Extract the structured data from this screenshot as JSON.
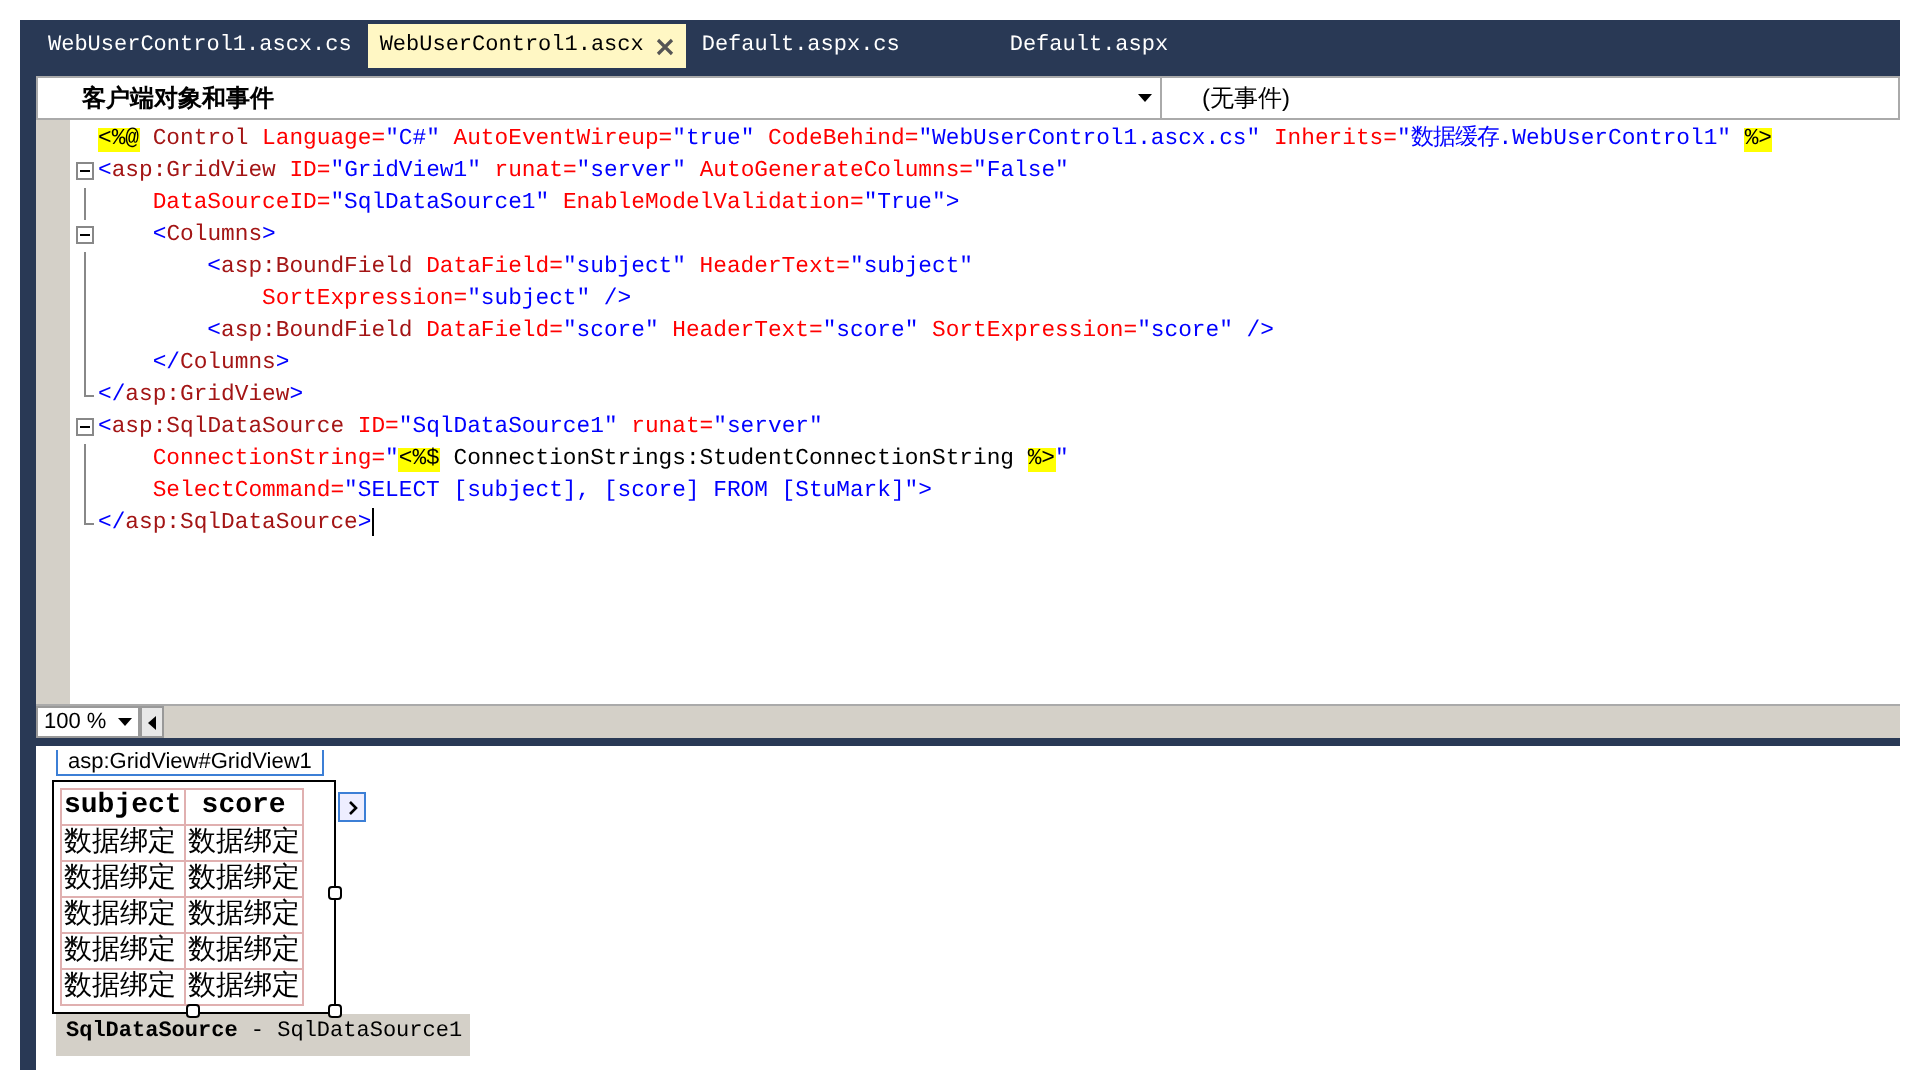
{
  "tabs": [
    {
      "label": "WebUserControl1.ascx.cs",
      "selected": false,
      "closable": false
    },
    {
      "label": "WebUserControl1.ascx",
      "selected": true,
      "closable": true
    },
    {
      "label": "Default.aspx.cs",
      "selected": false,
      "closable": false
    },
    {
      "label": "Default.aspx",
      "selected": false,
      "closable": false
    }
  ],
  "navigation": {
    "object_dropdown": "客户端对象和事件",
    "event_dropdown": "(无事件)"
  },
  "code_lines": [
    {
      "kind": "plain",
      "tokens": [
        {
          "kind": "directive",
          "text": "<%@"
        },
        {
          "kind": "element",
          "text": " Control "
        },
        {
          "kind": "attr",
          "text": "Language="
        },
        {
          "kind": "value",
          "text": "\"C#\" "
        },
        {
          "kind": "attr",
          "text": "AutoEventWireup="
        },
        {
          "kind": "value",
          "text": "\"true\" "
        },
        {
          "kind": "attr",
          "text": "CodeBehind="
        },
        {
          "kind": "value",
          "text": "\"WebUserControl1.ascx.cs\" "
        },
        {
          "kind": "attr",
          "text": "Inherits="
        },
        {
          "kind": "value",
          "text": "\"数据缓存.WebUserControl1\" "
        },
        {
          "kind": "directive",
          "text": "%>"
        }
      ]
    },
    {
      "kind": "fold-start",
      "tokens": [
        {
          "kind": "punct",
          "text": "<"
        },
        {
          "kind": "element",
          "text": "asp:GridView "
        },
        {
          "kind": "attr",
          "text": "ID="
        },
        {
          "kind": "value",
          "text": "\"GridView1\" "
        },
        {
          "kind": "attr",
          "text": "runat="
        },
        {
          "kind": "value",
          "text": "\"server\" "
        },
        {
          "kind": "attr",
          "text": "AutoGenerateColumns="
        },
        {
          "kind": "value",
          "text": "\"False\""
        }
      ]
    },
    {
      "kind": "fold-body",
      "tokens": [
        {
          "kind": "attr",
          "text": "    DataSourceID="
        },
        {
          "kind": "value",
          "text": "\"SqlDataSource1\" "
        },
        {
          "kind": "attr",
          "text": "EnableModelValidation="
        },
        {
          "kind": "value",
          "text": "\"True\""
        },
        {
          "kind": "punct",
          "text": ">"
        }
      ]
    },
    {
      "kind": "fold-start",
      "tokens": [
        {
          "kind": "punct",
          "text": "    <"
        },
        {
          "kind": "element",
          "text": "Columns"
        },
        {
          "kind": "punct",
          "text": ">"
        }
      ]
    },
    {
      "kind": "fold-body",
      "tokens": [
        {
          "kind": "punct",
          "text": "        <"
        },
        {
          "kind": "element",
          "text": "asp:BoundField "
        },
        {
          "kind": "attr",
          "text": "DataField="
        },
        {
          "kind": "value",
          "text": "\"subject\" "
        },
        {
          "kind": "attr",
          "text": "HeaderText="
        },
        {
          "kind": "value",
          "text": "\"subject\""
        }
      ]
    },
    {
      "kind": "fold-body",
      "tokens": [
        {
          "kind": "attr",
          "text": "            SortExpression="
        },
        {
          "kind": "value",
          "text": "\"subject\" "
        },
        {
          "kind": "punct",
          "text": "/>"
        }
      ]
    },
    {
      "kind": "fold-body",
      "tokens": [
        {
          "kind": "punct",
          "text": "        <"
        },
        {
          "kind": "element",
          "text": "asp:BoundField "
        },
        {
          "kind": "attr",
          "text": "DataField="
        },
        {
          "kind": "value",
          "text": "\"score\" "
        },
        {
          "kind": "attr",
          "text": "HeaderText="
        },
        {
          "kind": "value",
          "text": "\"score\" "
        },
        {
          "kind": "attr",
          "text": "SortExpression="
        },
        {
          "kind": "value",
          "text": "\"score\" "
        },
        {
          "kind": "punct",
          "text": "/>"
        }
      ]
    },
    {
      "kind": "fold-body",
      "tokens": [
        {
          "kind": "punct",
          "text": "    </"
        },
        {
          "kind": "element",
          "text": "Columns"
        },
        {
          "kind": "punct",
          "text": ">"
        }
      ]
    },
    {
      "kind": "fold-end",
      "tokens": [
        {
          "kind": "punct",
          "text": "</"
        },
        {
          "kind": "element",
          "text": "asp:GridView"
        },
        {
          "kind": "punct",
          "text": ">"
        }
      ]
    },
    {
      "kind": "fold-start",
      "tokens": [
        {
          "kind": "punct",
          "text": "<"
        },
        {
          "kind": "element",
          "text": "asp:SqlDataSource "
        },
        {
          "kind": "attr",
          "text": "ID="
        },
        {
          "kind": "value",
          "text": "\"SqlDataSource1\" "
        },
        {
          "kind": "attr",
          "text": "runat="
        },
        {
          "kind": "value",
          "text": "\"server\""
        }
      ]
    },
    {
      "kind": "fold-body",
      "tokens": [
        {
          "kind": "attr",
          "text": "    ConnectionString="
        },
        {
          "kind": "value",
          "text": "\""
        },
        {
          "kind": "directive",
          "text": "<%$"
        },
        {
          "kind": "plain",
          "text": " ConnectionStrings:StudentConnectionString "
        },
        {
          "kind": "directive",
          "text": "%>"
        },
        {
          "kind": "value",
          "text": "\""
        }
      ]
    },
    {
      "kind": "fold-body",
      "tokens": [
        {
          "kind": "attr",
          "text": "    SelectCommand="
        },
        {
          "kind": "value",
          "text": "\"SELECT [subject], [score] FROM [StuMark]\""
        },
        {
          "kind": "punct",
          "text": ">"
        }
      ]
    },
    {
      "kind": "fold-end",
      "tokens": [
        {
          "kind": "punct",
          "text": "</"
        },
        {
          "kind": "element",
          "text": "asp:SqlDataSource"
        },
        {
          "kind": "punct",
          "text": ">"
        }
      ]
    }
  ],
  "zoom": "100 %",
  "design": {
    "breadcrumb": "asp:GridView#GridView1",
    "grid": {
      "columns": [
        "subject",
        "score"
      ],
      "rows": [
        [
          "数据绑定",
          "数据绑定"
        ],
        [
          "数据绑定",
          "数据绑定"
        ],
        [
          "数据绑定",
          "数据绑定"
        ],
        [
          "数据绑定",
          "数据绑定"
        ],
        [
          "数据绑定",
          "数据绑定"
        ]
      ]
    },
    "data_source": {
      "type": "SqlDataSource",
      "name": " - SqlDataSource1"
    }
  }
}
